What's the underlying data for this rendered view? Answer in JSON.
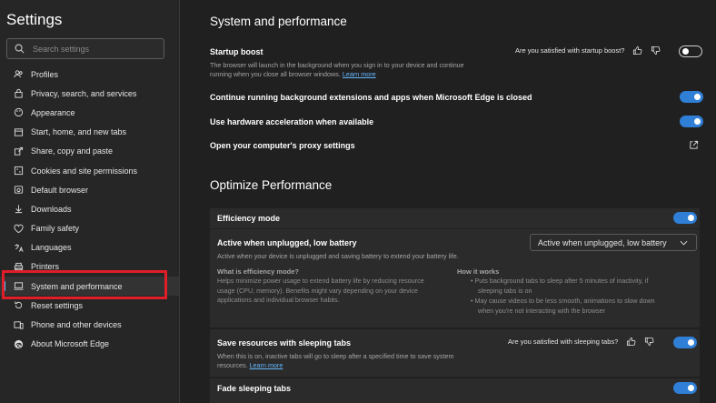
{
  "sidebar": {
    "title": "Settings",
    "search_placeholder": "Search settings",
    "items": [
      {
        "label": "Profiles",
        "icon": "profiles-icon"
      },
      {
        "label": "Privacy, search, and services",
        "icon": "lock-icon"
      },
      {
        "label": "Appearance",
        "icon": "appearance-icon"
      },
      {
        "label": "Start, home, and new tabs",
        "icon": "home-icon"
      },
      {
        "label": "Share, copy and paste",
        "icon": "share-icon"
      },
      {
        "label": "Cookies and site permissions",
        "icon": "cookies-icon"
      },
      {
        "label": "Default browser",
        "icon": "browser-icon"
      },
      {
        "label": "Downloads",
        "icon": "download-icon"
      },
      {
        "label": "Family safety",
        "icon": "family-icon"
      },
      {
        "label": "Languages",
        "icon": "languages-icon"
      },
      {
        "label": "Printers",
        "icon": "printer-icon"
      },
      {
        "label": "System and performance",
        "icon": "system-icon"
      },
      {
        "label": "Reset settings",
        "icon": "reset-icon"
      },
      {
        "label": "Phone and other devices",
        "icon": "phone-icon"
      },
      {
        "label": "About Microsoft Edge",
        "icon": "edge-icon"
      }
    ],
    "active_item": "System and performance"
  },
  "main": {
    "section_title": "System and performance",
    "startup_boost": {
      "title": "Startup boost",
      "desc_line1": "The browser will launch in the background when you sign in to your device and continue",
      "desc_line2": "running when you close all browser windows.",
      "learn_more": "Learn more",
      "feedback": "Are you satisfied with startup boost?",
      "enabled": false
    },
    "background_ext": {
      "title": "Continue running background extensions and apps when Microsoft Edge is closed",
      "enabled": true
    },
    "hw_accel": {
      "title": "Use hardware acceleration when available",
      "enabled": true
    },
    "proxy": {
      "title": "Open your computer's proxy settings",
      "icon": "external-link-icon"
    },
    "optimize_title": "Optimize Performance",
    "efficiency_mode": {
      "title": "Efficiency mode",
      "enabled": true
    },
    "active_when": {
      "title": "Active when unplugged, low battery",
      "desc": "Active when your device is unplugged and saving battery to extend your battery life.",
      "dropdown_value": "Active when unplugged, low battery"
    },
    "what_is": {
      "heading": "What is efficiency mode?",
      "line1": "Helps minimize power usage to extend battery life by reducing resource",
      "line2": "usage (CPU, memory). Benefits might vary depending on your device",
      "line3": "applications and individual browser habits."
    },
    "how_it_works": {
      "heading": "How it works",
      "b1_line1": "Puts background tabs to sleep after 5 minutes of inactivity, if",
      "b1_line2": "sleeping tabs is on",
      "b2_line1": "May cause videos to be less smooth, animations to slow down",
      "b2_line2": "when you're not interacting with the browser"
    },
    "sleeping_tabs": {
      "title": "Save resources with sleeping tabs",
      "desc_line1": "When this is on, inactive tabs will go to sleep after a specified time to save system",
      "desc_line2": "resources.",
      "learn_more": "Learn more",
      "feedback": "Are you satisfied with sleeping tabs?",
      "enabled": true
    },
    "fade_sleeping": {
      "title": "Fade sleeping tabs",
      "enabled": true
    }
  },
  "colors": {
    "accent": "#2f7fd6",
    "link": "#63b8ff",
    "highlight_box": "#e01e28"
  }
}
